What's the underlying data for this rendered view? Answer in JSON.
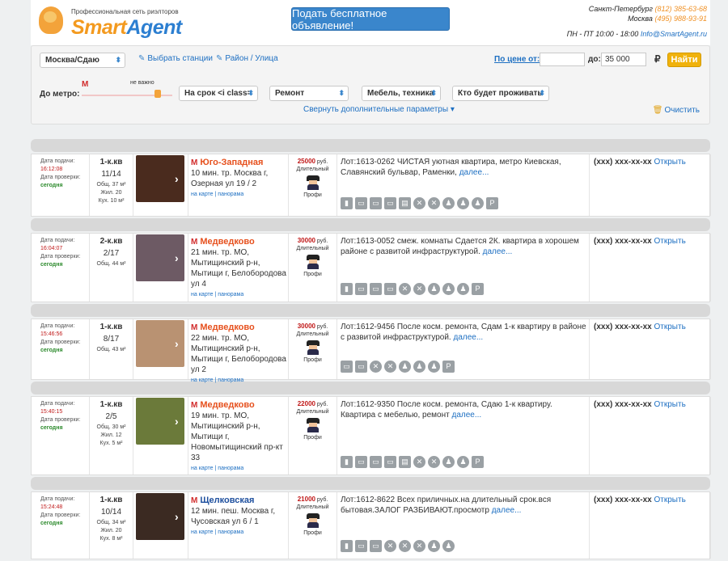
{
  "header": {
    "tagline": "Профессиональная сеть риэлторов",
    "logo_smart": "Smart",
    "logo_agent": "Agent",
    "post_button": "Подать бесплатное объявление!",
    "spb_label": "Санкт-Петербург",
    "spb_phone": "(812) 385-63-68",
    "msk_label": "Москва",
    "msk_phone": "(495) 988-93-91",
    "hours": "ПН - ПТ 10:00 - 18:00",
    "email": "Info@SmartAgent.ru"
  },
  "filter": {
    "city_select": "Москва/Сдаю",
    "stations_link": "Выбрать станции",
    "district_link": "Район / Улица",
    "price_from_label": "По цене от:",
    "price_from_value": "",
    "price_to_label": "до:",
    "price_to_value": "35 000",
    "currency": "₽",
    "find_button": "Найти",
    "metro_label": "До метро:",
    "metro_slider_label": "не важно",
    "term_select": "На срок <i class=",
    "repair_select": "Ремонт",
    "furniture_select": "Мебель, техника",
    "who_select": "Кто будет проживать",
    "collapse_link": "Свернуть дополнительные параметры",
    "clear_link": "Очистить"
  },
  "listings": [
    {
      "date_label": "Дата подачи:",
      "date_time": "16:12:08",
      "check_label": "Дата проверки:",
      "check_value": "сегодня",
      "rooms": "1-к.кв",
      "floor": "11/14",
      "area_total": "Общ. 37 м²",
      "area_living": "Жил. 20",
      "area_kitchen": "Кух. 10 м²",
      "station": "Юго-Западная",
      "station_color": "#e6501d",
      "address": "10 мин. тр. Москва г, Озерная ул 19 / 2",
      "map_link": "на карте",
      "pano_link": "панорама",
      "price": "25000",
      "price_unit": "руб.",
      "term": "Длительный",
      "agent": "Профи",
      "description": "Лот:1613-0262 ЧИСТАЯ уютная квартира, метро Киевская, Славянский бульвар, Раменки,",
      "more_link": "далее...",
      "phone": "(xxx) xxx-xx-xx",
      "open_link": "Открыть",
      "photo_color": "#4a2b1e"
    },
    {
      "date_label": "Дата подачи:",
      "date_time": "16:04:07",
      "check_label": "Дата проверки:",
      "check_value": "сегодня",
      "rooms": "2-к.кв",
      "floor": "2/17",
      "area_total": "Общ. 44 м²",
      "area_living": "",
      "area_kitchen": "",
      "station": "Медведково",
      "station_color": "#e6501d",
      "address": "21 мин. тр. МО, Мытищинский р-н, Мытищи г, Белобородова ул 4",
      "map_link": "на карте",
      "pano_link": "панорама",
      "price": "30000",
      "price_unit": "руб.",
      "term": "Длительный",
      "agent": "Профи",
      "description": "Лот:1613-0052 смеж. комнаты Сдается 2К. квартира в хорошем районе с развитой инфраструктурой.",
      "more_link": "далее...",
      "phone": "(xxx) xxx-xx-xx",
      "open_link": "Открыть",
      "photo_color": "#6d5a64"
    },
    {
      "date_label": "Дата подачи:",
      "date_time": "15:46:56",
      "check_label": "Дата проверки:",
      "check_value": "сегодня",
      "rooms": "1-к.кв",
      "floor": "8/17",
      "area_total": "Общ. 43 м²",
      "area_living": "",
      "area_kitchen": "",
      "station": "Медведково",
      "station_color": "#e6501d",
      "address": "22 мин. тр. МО, Мытищинский р-н, Мытищи г, Белобородова ул 2",
      "map_link": "на карте",
      "pano_link": "панорама",
      "price": "30000",
      "price_unit": "руб.",
      "term": "Длительный",
      "agent": "Профи",
      "description": "Лот:1612-9456 После косм. ремонта, Сдам 1-к квартиру в районе с развитой инфраструктурой.",
      "more_link": "далее...",
      "phone": "(xxx) xxx-xx-xx",
      "open_link": "Открыть",
      "photo_color": "#b99272"
    },
    {
      "date_label": "Дата подачи:",
      "date_time": "15:40:15",
      "check_label": "Дата проверки:",
      "check_value": "сегодня",
      "rooms": "1-к.кв",
      "floor": "2/5",
      "area_total": "Общ. 30 м²",
      "area_living": "Жил. 12",
      "area_kitchen": "Кух. 5 м²",
      "station": "Медведково",
      "station_color": "#e6501d",
      "address": "19 мин. тр. МО, Мытищинский р-н, Мытищи г, Новомытищинский пр-кт 33",
      "map_link": "на карте",
      "pano_link": "панорама",
      "price": "22000",
      "price_unit": "руб.",
      "term": "Длительный",
      "agent": "Профи",
      "description": "Лот:1612-9350 После косм. ремонта, Сдаю 1-к квартиру. Квартира с мебелью, ремонт",
      "more_link": "далее...",
      "phone": "(xxx) xxx-xx-xx",
      "open_link": "Открыть",
      "photo_color": "#6b7a3a"
    },
    {
      "date_label": "Дата подачи:",
      "date_time": "15:24:48",
      "check_label": "Дата проверки:",
      "check_value": "сегодня",
      "rooms": "1-к.кв",
      "floor": "10/14",
      "area_total": "Общ. 34 м²",
      "area_living": "Жил. 20",
      "area_kitchen": "Кух. 8 м²",
      "station": "Щелковская",
      "station_color": "#1d4f9e",
      "address": "12 мин. пеш. Москва г, Чусовская ул 6 / 1",
      "map_link": "на карте",
      "pano_link": "панорама",
      "price": "21000",
      "price_unit": "руб.",
      "term": "Длительный",
      "agent": "Профи",
      "description": "Лот:1612-8622 Всех приличных.на длительный срок.вся бытовая.ЗАЛОГ РАЗБИВАЮТ.просмотр",
      "more_link": "далее...",
      "phone": "(xxx) xxx-xx-xx",
      "open_link": "Открыть",
      "photo_color": "#3b2a22"
    }
  ]
}
